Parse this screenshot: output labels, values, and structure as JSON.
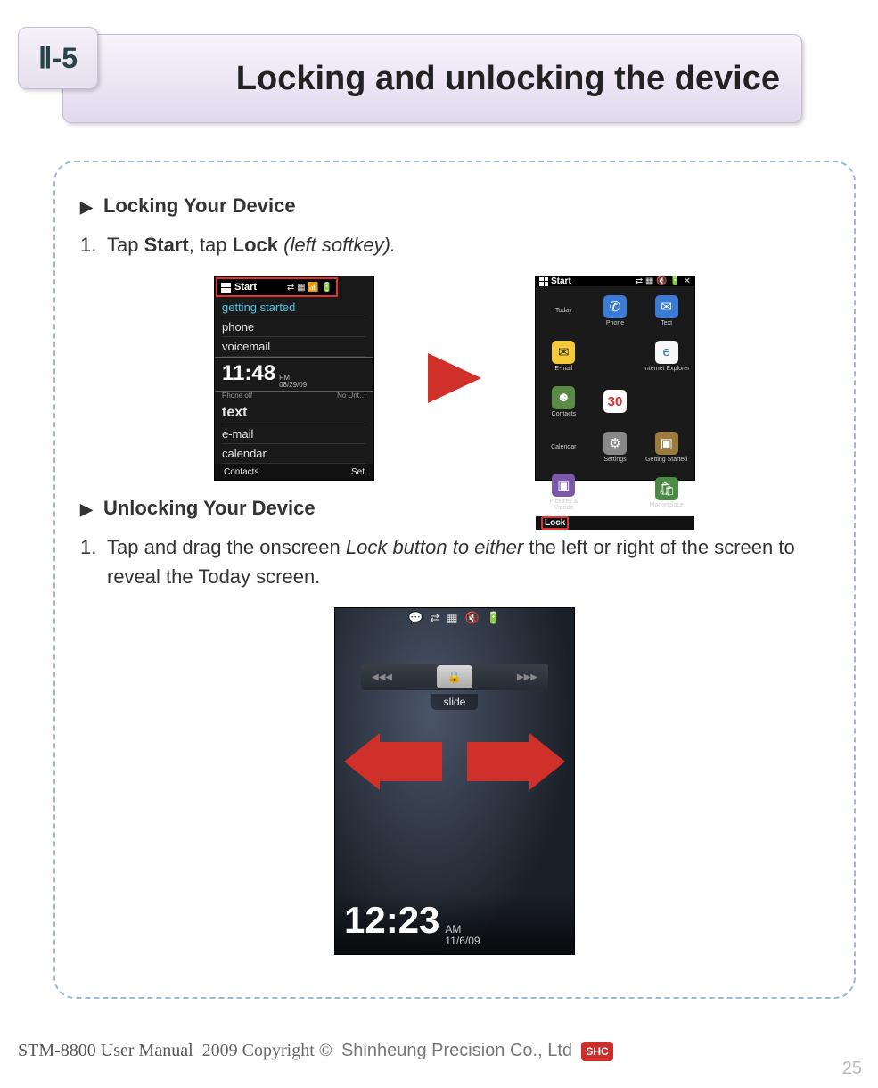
{
  "chapter_label": "Ⅱ-5",
  "page_title": "Locking and unlocking the device",
  "sections": {
    "lock": {
      "heading": "Locking Your Device",
      "step_num": "1.",
      "step_pre": "Tap ",
      "step_b1": "Start",
      "step_mid": ", tap ",
      "step_b2": "Lock",
      "step_post_i": " (left softkey)."
    },
    "unlock": {
      "heading": "Unlocking Your Device",
      "step_num": "1.",
      "step_pre": "Tap and drag the onscreen ",
      "step_i": "Lock button to either",
      "step_post": " the left or right of the screen to reveal the Today screen."
    }
  },
  "phoneA": {
    "start": "Start",
    "items_top": [
      "getting started",
      "phone",
      "voicemail"
    ],
    "clock_time": "11:48",
    "clock_ampm": "PM",
    "clock_date": "08/29/09",
    "sub_left": "Phone off",
    "sub_right": "No Unt…",
    "item_big": "text",
    "items_bottom": [
      "e-mail",
      "calendar"
    ],
    "foot_left": "Contacts",
    "foot_right": "Set"
  },
  "phoneB": {
    "start": "Start",
    "cells": [
      {
        "label": "Today",
        "cls": ""
      },
      {
        "label": "Phone",
        "cls": "ic-ph",
        "glyph": "✆"
      },
      {
        "label": "Text",
        "cls": "ic-tx",
        "glyph": "✉"
      },
      {
        "label": "E-mail",
        "cls": "ic-em",
        "glyph": "✉"
      },
      {
        "label": "",
        "cls": ""
      },
      {
        "label": "Internet Explorer",
        "cls": "ic-ie",
        "glyph": "e"
      },
      {
        "label": "Contacts",
        "cls": "ic-cn",
        "glyph": "☻"
      },
      {
        "label": "",
        "cls": "ic-cal",
        "glyph": "30"
      },
      {
        "label": "",
        "cls": ""
      },
      {
        "label": "Calendar",
        "cls": ""
      },
      {
        "label": "Settings",
        "cls": "ic-set",
        "glyph": "⚙"
      },
      {
        "label": "Getting Started",
        "cls": "ic-gs",
        "glyph": "▣"
      },
      {
        "label": "Pictures & Videos",
        "cls": "ic-pic",
        "glyph": "▣"
      },
      {
        "label": "",
        "cls": ""
      },
      {
        "label": "Marketplace",
        "cls": "ic-mk",
        "glyph": "🛍"
      }
    ],
    "lock_label": "Lock"
  },
  "phoneC": {
    "slide_label": "slide",
    "clock_time": "12:23",
    "clock_ampm": "AM",
    "clock_date": "11/6/09"
  },
  "footer": {
    "manual": "STM-8800 User Manual",
    "copyright": "2009 Copyright ©",
    "company": "Shinheung Precision Co., Ltd",
    "logo": "SHC"
  },
  "page_number": "25"
}
